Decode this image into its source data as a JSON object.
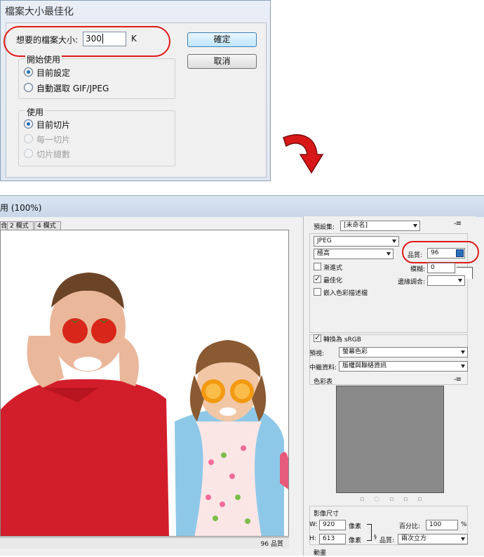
{
  "dialog": {
    "title": "檔案大小最佳化",
    "size_label": "想要的檔案大小:",
    "size_value": "300",
    "size_unit": "K",
    "ok_label": "確定",
    "cancel_label": "取消",
    "group1": {
      "title": "開始使用",
      "options": [
        "目前設定",
        "自動選取 GIF/JPEG"
      ],
      "selected": 0
    },
    "group2": {
      "title": "使用",
      "options": [
        "目前切片",
        "每一切片",
        "切片總數"
      ],
      "selected": 0,
      "disabled": [
        1,
        2
      ]
    }
  },
  "window": {
    "title": "用 (100%)",
    "tabs": [
      "合",
      "2 欄式",
      "4 欄式"
    ],
    "status_text": "96 品質",
    "panel": {
      "preset_label": "預設集:",
      "preset_value": "[未命名]",
      "format_value": "JPEG",
      "compression_value": "極高",
      "quality_label": "品質:",
      "quality_value": "96",
      "progressive_label": "漸進式",
      "progressive_checked": false,
      "blur_label": "模糊:",
      "blur_value": "0",
      "optimized_label": "最佳化",
      "optimized_checked": true,
      "matte_label": "邊緣調合:",
      "embed_label": "嵌入色彩描述檔",
      "embed_checked": false,
      "srgb_label": "轉換為 sRGB",
      "srgb_checked": true,
      "preview_label": "預視:",
      "preview_value": "螢幕色彩",
      "metadata_label": "中繼資料:",
      "metadata_value": "版權與聯絡資訊",
      "color_table_label": "色彩表",
      "image_size_label": "影像尺寸",
      "width_label": "W:",
      "width_value": "920",
      "height_label": "H:",
      "height_value": "613",
      "px_unit": "像素",
      "percent_label": "百分比:",
      "percent_value": "100",
      "percent_unit": "%",
      "quality2_label": "品質:",
      "quality2_value": "兩次立方",
      "animation_label": "動畫"
    }
  },
  "colors": {
    "annotation_red": "#e01818",
    "tomato": "#d8261a",
    "orange": "#f39a12",
    "boy_shirt": "#d21e2a",
    "girl_jacket": "#8ec8e8"
  }
}
